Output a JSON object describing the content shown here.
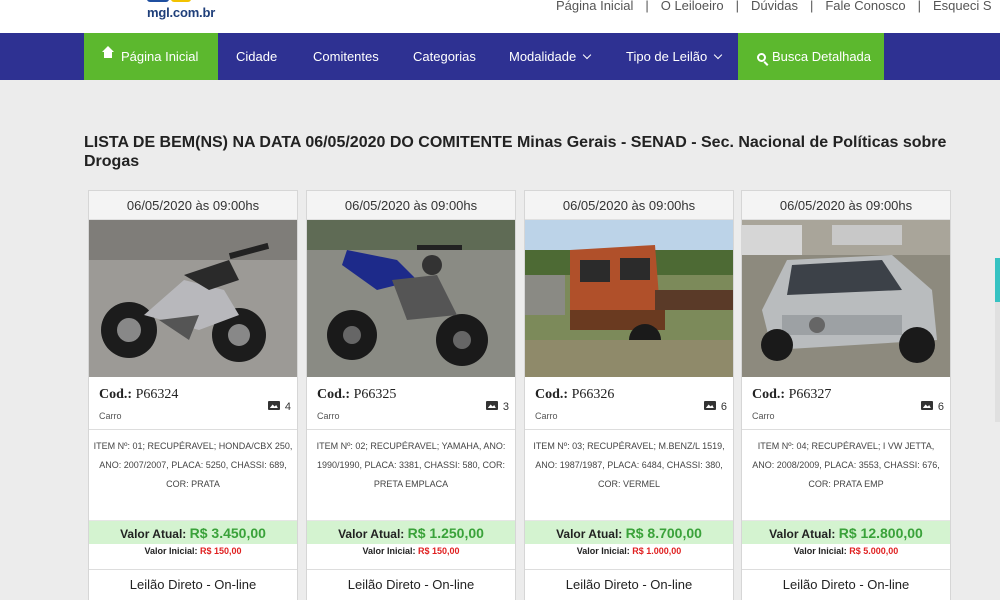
{
  "header": {
    "logo_text": "mgl.com.br",
    "links": [
      "Página Inicial",
      "O Leiloeiro",
      "Dúvidas",
      "Fale Conosco",
      "Esqueci S"
    ]
  },
  "nav": {
    "home": "Página Inicial",
    "cidade": "Cidade",
    "comitentes": "Comitentes",
    "categorias": "Categorias",
    "modalidade": "Modalidade",
    "tipo": "Tipo de Leilão",
    "busca": "Busca Detalhada"
  },
  "page": {
    "title": "LISTA DE BEM(NS) NA DATA 06/05/2020 DO COMITENTE Minas Gerais - SENAD - Sec. Nacional de Políticas sobre Drogas"
  },
  "colors": {
    "nav_bg": "#2e3192",
    "accent_green": "#5cb82e",
    "valor_green": "#3aa23a",
    "valor_bg": "#d4f3d0",
    "inicial_red": "#e02020"
  },
  "cards": [
    {
      "date": "06/05/2020 às 09:00hs",
      "code_label": "Cod.:",
      "code": "P66324",
      "category": "Carro",
      "photos": "4",
      "description": "ITEM Nº: 01; RECUPÉRAVEL; HONDA/CBX 250, ANO: 2007/2007, PLACA: 5250, CHASSI: 689, COR: PRATA",
      "valor_label": "Valor Atual:",
      "valor": "R$ 3.450,00",
      "inicial_label": "Valor Inicial:",
      "inicial": "R$ 150,00",
      "mode": "Leilão Direto - On-line"
    },
    {
      "date": "06/05/2020 às 09:00hs",
      "code_label": "Cod.:",
      "code": "P66325",
      "category": "Carro",
      "photos": "3",
      "description": "ITEM Nº: 02; RECUPÉRAVEL; YAMAHA, ANO: 1990/1990, PLACA: 3381, CHASSI: 580, COR: PRETA EMPLACA",
      "valor_label": "Valor Atual:",
      "valor": "R$ 1.250,00",
      "inicial_label": "Valor Inicial:",
      "inicial": "R$ 150,00",
      "mode": "Leilão Direto - On-line"
    },
    {
      "date": "06/05/2020 às 09:00hs",
      "code_label": "Cod.:",
      "code": "P66326",
      "category": "Carro",
      "photos": "6",
      "description": "ITEM Nº: 03; RECUPÉRAVEL; M.BENZ/L 1519, ANO: 1987/1987, PLACA: 6484, CHASSI: 380, COR: VERMEL",
      "valor_label": "Valor Atual:",
      "valor": "R$ 8.700,00",
      "inicial_label": "Valor Inicial:",
      "inicial": "R$ 1.000,00",
      "mode": "Leilão Direto - On-line"
    },
    {
      "date": "06/05/2020 às 09:00hs",
      "code_label": "Cod.:",
      "code": "P66327",
      "category": "Carro",
      "photos": "6",
      "description": "ITEM Nº: 04; RECUPÉRAVEL; I VW JETTA, ANO: 2008/2009, PLACA: 3553, CHASSI: 676, COR: PRATA EMP",
      "valor_label": "Valor Atual:",
      "valor": "R$ 12.800,00",
      "inicial_label": "Valor Inicial:",
      "inicial": "R$ 5.000,00",
      "mode": "Leilão Direto - On-line"
    }
  ]
}
